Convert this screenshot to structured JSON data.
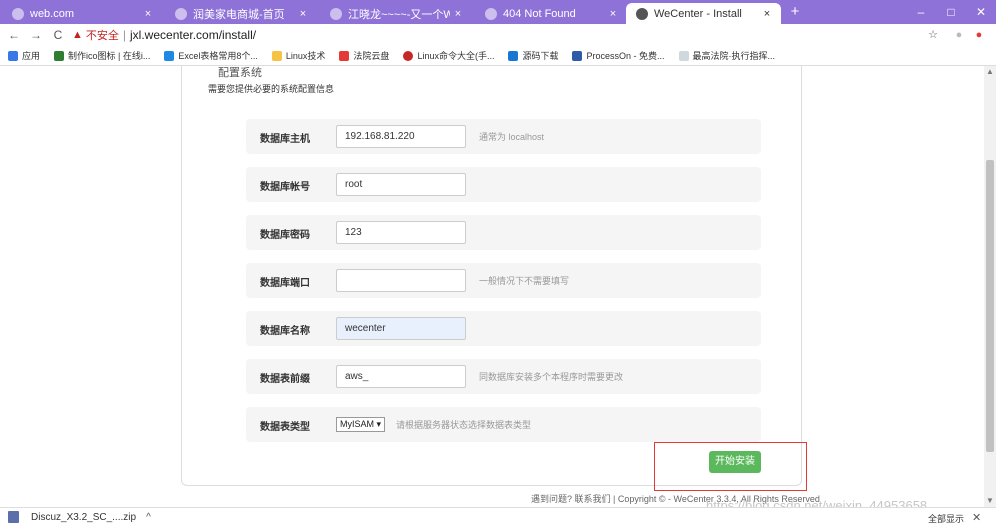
{
  "tabs": [
    {
      "title": "web.com",
      "close": "×"
    },
    {
      "title": "润美家电商城-首页",
      "close": "×"
    },
    {
      "title": "江晓龙~~~~-又一个WordPress",
      "close": "×"
    },
    {
      "title": "404 Not Found",
      "close": "×"
    },
    {
      "title": "WeCenter - Install",
      "close": "×"
    }
  ],
  "new_tab": "+",
  "window_controls": {
    "minimize": "–",
    "maximize": "□",
    "close": "✕"
  },
  "nav": {
    "back": "←",
    "forward": "→",
    "reload": "C"
  },
  "address": {
    "warning_icon": "▲",
    "insecure_label": "不安全",
    "separator": "|",
    "url": "jxl.wecenter.com/install/"
  },
  "toolbar_icons": {
    "star": "☆",
    "account": "●",
    "extension": "●"
  },
  "bookmarks": [
    {
      "label": "应用",
      "color": "#3b78e7"
    },
    {
      "label": "制作ico图标 | 在线i...",
      "color": "#2e7d32"
    },
    {
      "label": "Excel表格常用8个...",
      "color": "#1e88e5"
    },
    {
      "label": "Linux技术",
      "color": "#f6c344"
    },
    {
      "label": "法院云盘",
      "color": "#e53935"
    },
    {
      "label": "Linux命令大全(手...",
      "color": "#c62828"
    },
    {
      "label": "源码下载",
      "color": "#1976d2"
    },
    {
      "label": "ProcessOn - 免费...",
      "color": "#2e5aa7"
    },
    {
      "label": "最高法院·执行指挥...",
      "color": "#cfd8dc"
    }
  ],
  "page": {
    "cut_text": "配置系统",
    "intro": "需要您提供必要的系统配置信息",
    "rows": [
      {
        "label": "数据库主机",
        "value": "192.168.81.220",
        "hint": "通常为 localhost"
      },
      {
        "label": "数据库帐号",
        "value": "root",
        "hint": ""
      },
      {
        "label": "数据库密码",
        "value": "123",
        "hint": ""
      },
      {
        "label": "数据库端口",
        "value": "",
        "hint": "一般情况下不需要填写"
      },
      {
        "label": "数据库名称",
        "value": "wecenter",
        "hint": ""
      },
      {
        "label": "数据表前缀",
        "value": "aws_",
        "hint": "同数据库安装多个本程序时需要更改"
      }
    ],
    "table_type": {
      "label": "数据表类型",
      "selected": "MyISAM ▾",
      "hint": "请根据服务器状态选择数据表类型"
    },
    "install_button": "开始安装",
    "footer": "遇到问题? 联系我们 | Copyright © - WeCenter 3.3.4, All Rights Reserved",
    "watermark": "https://blog.csdn.net/weixin_44953658"
  },
  "scroll": {
    "up": "▲",
    "down": "▼"
  },
  "downloads": {
    "file": "Discuz_X3.2_SC_....zip",
    "caret": "^",
    "show_all": "全部显示",
    "close": "✕"
  }
}
